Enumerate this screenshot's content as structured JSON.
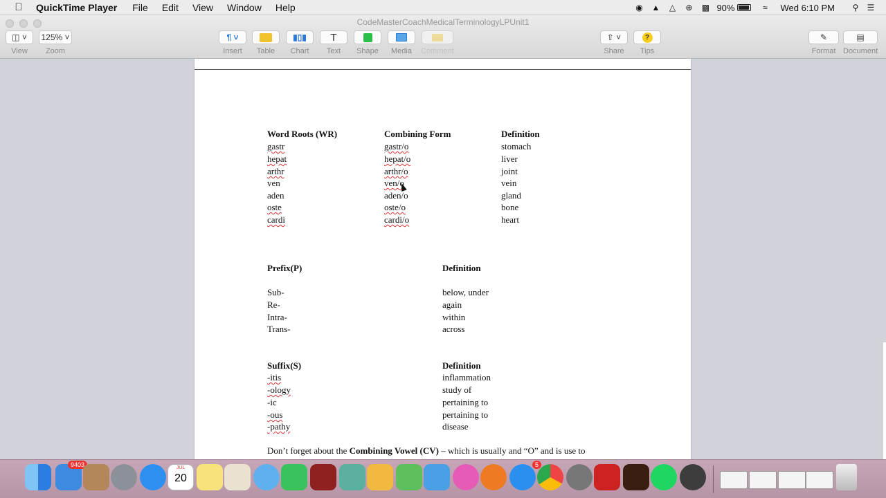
{
  "menubar": {
    "app_name": "QuickTime Player",
    "items": [
      "File",
      "Edit",
      "View",
      "Window",
      "Help"
    ],
    "battery": "90%",
    "clock": "Wed 6:10 PM"
  },
  "window": {
    "title": "CodeMasterCoachMedicalTerminologyLPUnit1",
    "toolbar": {
      "view": "View",
      "zoom_value": "125%",
      "zoom": "Zoom",
      "insert": "Insert",
      "table": "Table",
      "chart": "Chart",
      "text": "Text",
      "shape": "Shape",
      "media": "Media",
      "comment": "Comment",
      "share": "Share",
      "tips": "Tips",
      "format": "Format",
      "document": "Document"
    }
  },
  "document": {
    "word_roots": {
      "headers": [
        "Word Roots (WR)",
        "Combining Form",
        "Definition"
      ],
      "rows": [
        [
          "gastr",
          "gastr/o",
          "stomach"
        ],
        [
          "hepat",
          "hepat/o",
          "liver"
        ],
        [
          "arthr",
          "arthr/o",
          "joint"
        ],
        [
          "ven",
          "ven/o",
          "vein"
        ],
        [
          "aden",
          "aden/o",
          "gland"
        ],
        [
          "oste",
          "oste/o",
          "bone"
        ],
        [
          "cardi",
          "cardi/o",
          "heart"
        ]
      ]
    },
    "prefix": {
      "headers": [
        "Prefix(P)",
        "Definition"
      ],
      "rows": [
        [
          "Sub-",
          "below, under"
        ],
        [
          "Re-",
          "again"
        ],
        [
          "Intra-",
          "within"
        ],
        [
          "Trans-",
          "across"
        ]
      ]
    },
    "suffix": {
      "headers": [
        "Suffix(S)",
        "Definition"
      ],
      "rows": [
        [
          "-itis",
          "inflammation"
        ],
        [
          "-ology",
          "study of"
        ],
        [
          "-ic",
          "pertaining to"
        ],
        [
          "-ous",
          "pertaining to"
        ],
        [
          "-pathy",
          "disease"
        ]
      ]
    },
    "footer_text": {
      "before": "Don’t forget about the ",
      "bold": "Combining Vowel (CV)",
      "after": " – which is usually and “O” and is use to"
    }
  },
  "dock": {
    "mail_badge": "9403",
    "calendar_month": "JUL",
    "calendar_day": "20",
    "appstore_badge": "5"
  }
}
